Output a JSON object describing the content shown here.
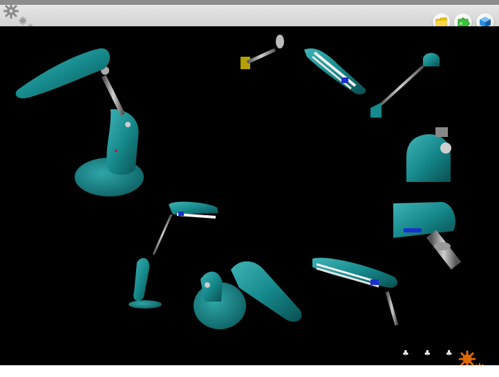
{
  "header": {
    "nav_buttons": [
      {
        "icon": "folder-icon",
        "color": "#f2c100"
      },
      {
        "icon": "puzzle-icon",
        "color": "#3cc13c"
      },
      {
        "icon": "cube-icon",
        "color": "#2f8fe0"
      }
    ]
  },
  "stage": {
    "background": "#000000",
    "subject": "desk-lamp",
    "accent": "#1a8a8c"
  },
  "footer": {
    "marks": "♣ ♣ ♣"
  }
}
